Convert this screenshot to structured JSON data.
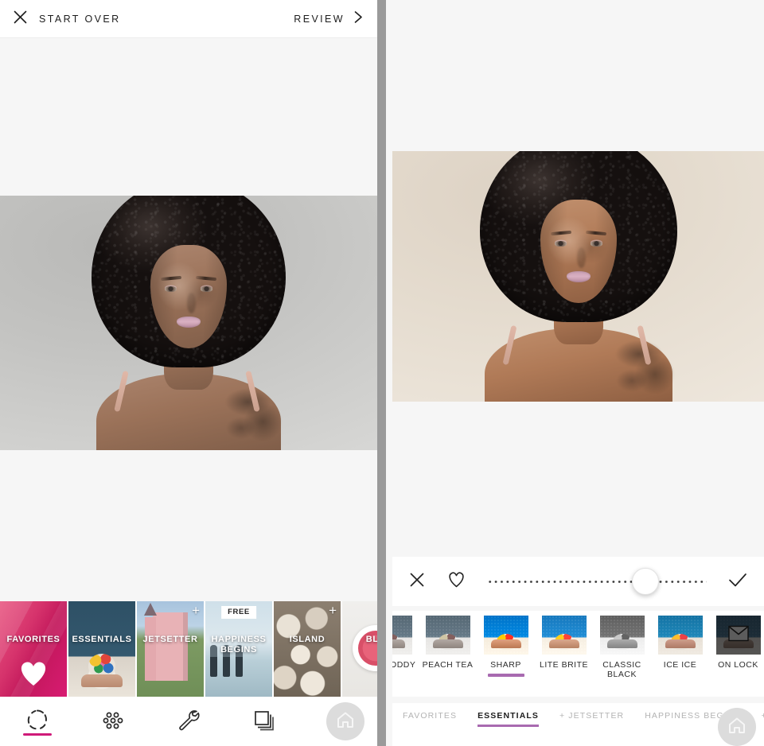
{
  "app": {
    "name": "photo-filter-editor"
  },
  "left_screen": {
    "header": {
      "close_icon": "close-icon",
      "start_over_label": "START OVER",
      "review_label": "REVIEW",
      "chevron_icon": "chevron-right-icon"
    },
    "photo": {
      "alt": "portrait of woman with curly afro hair, unfiltered",
      "background_color": "#c3c3c1"
    },
    "packs": [
      {
        "title": "FAVORITES",
        "badge": "",
        "plus": false,
        "kind": "favorites"
      },
      {
        "title": "ESSENTIALS",
        "badge": "",
        "plus": false,
        "kind": "essentials"
      },
      {
        "title": "JETSETTER",
        "badge": "",
        "plus": true,
        "kind": "jetsetter"
      },
      {
        "title": "HAPPINESS BEGINS",
        "badge": "FREE",
        "plus": false,
        "kind": "happiness"
      },
      {
        "title": "ISLAND",
        "badge": "",
        "plus": true,
        "kind": "island"
      },
      {
        "title": "BLU",
        "badge": "",
        "plus": false,
        "kind": "blu"
      }
    ],
    "tabbar": [
      {
        "name": "filters-tab",
        "icon": "filter-ring-icon",
        "active": true
      },
      {
        "name": "effects-tab",
        "icon": "dots-cluster-icon",
        "active": false
      },
      {
        "name": "tools-tab",
        "icon": "wrench-icon",
        "active": false
      },
      {
        "name": "layers-tab",
        "icon": "layers-icon",
        "active": false
      },
      {
        "name": "shop-tab",
        "icon": "cart-icon",
        "active": false
      }
    ],
    "home_button": {
      "icon": "home-icon"
    },
    "accent_color": "#cf1a79"
  },
  "right_screen": {
    "photo": {
      "alt": "portrait of woman with curly afro hair, Sharp filter applied",
      "background_color": "#e5dccf"
    },
    "slider": {
      "cancel_icon": "close-icon",
      "favorite_icon": "heart-outline-icon",
      "confirm_icon": "check-icon",
      "value_percent": 72
    },
    "filters": [
      {
        "name": "HOT TODDY",
        "selected": false,
        "locked": false,
        "style": "th-peach",
        "partial": true
      },
      {
        "name": "PEACH TEA",
        "selected": false,
        "locked": false,
        "style": "th-peach"
      },
      {
        "name": "SHARP",
        "selected": true,
        "locked": false,
        "style": "th-sharp"
      },
      {
        "name": "LITE BRITE",
        "selected": false,
        "locked": false,
        "style": "th-lite"
      },
      {
        "name": "CLASSIC BLACK",
        "selected": false,
        "locked": false,
        "style": "th-bw"
      },
      {
        "name": "ICE ICE",
        "selected": false,
        "locked": false,
        "style": "th-ice"
      },
      {
        "name": "ON LOCK",
        "selected": false,
        "locked": true,
        "style": "th-lock",
        "lock_icon": "envelope-icon"
      }
    ],
    "categories": [
      {
        "label": "FAVORITES",
        "active": false
      },
      {
        "label": "ESSENTIALS",
        "active": true
      },
      {
        "label": "+ JETSETTER",
        "active": false
      },
      {
        "label": "HAPPINESS BEGINS",
        "active": false
      },
      {
        "label": "+ IS",
        "active": false
      }
    ],
    "home_button": {
      "icon": "home-icon"
    },
    "accent_color": "#a86ab0"
  }
}
